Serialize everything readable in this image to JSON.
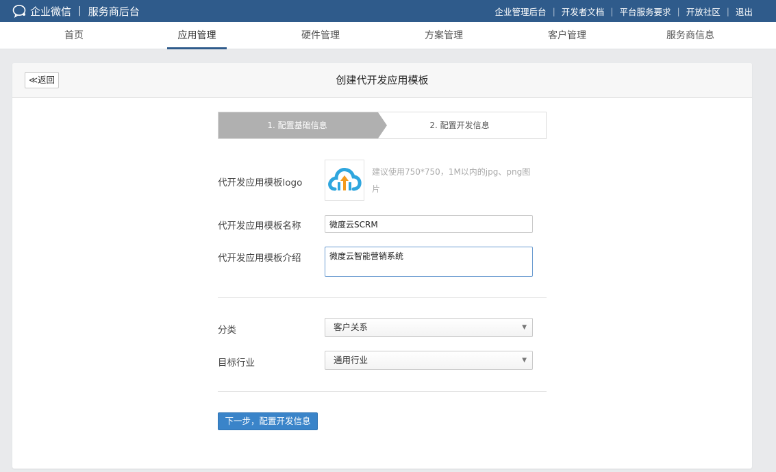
{
  "topbar": {
    "brand": "企业微信",
    "separator": "|",
    "subtitle": "服务商后台",
    "links": [
      "企业管理后台",
      "开发者文档",
      "平台服务要求",
      "开放社区",
      "退出"
    ]
  },
  "nav": {
    "items": [
      "首页",
      "应用管理",
      "硬件管理",
      "方案管理",
      "客户管理",
      "服务商信息"
    ],
    "active_index": 1
  },
  "page": {
    "back_label": "≪返回",
    "title": "创建代开发应用模板"
  },
  "steps": {
    "step1": "1. 配置基础信息",
    "step2": "2. 配置开发信息"
  },
  "form": {
    "logo_label": "代开发应用模板logo",
    "logo_hint": "建议使用750*750，1M以内的jpg、png图片",
    "logo_icon": "cloud-upload-icon",
    "name_label": "代开发应用模板名称",
    "name_value": "微度云SCRM",
    "intro_label": "代开发应用模板介绍",
    "intro_value": "微度云智能营销系统",
    "category_label": "分类",
    "category_value": "客户关系",
    "industry_label": "目标行业",
    "industry_value": "通用行业",
    "submit_label": "下一步，配置开发信息"
  },
  "colors": {
    "topbar": "#2f5b8b",
    "primary_button": "#3a84c9",
    "step_active": "#b0b0b0"
  }
}
